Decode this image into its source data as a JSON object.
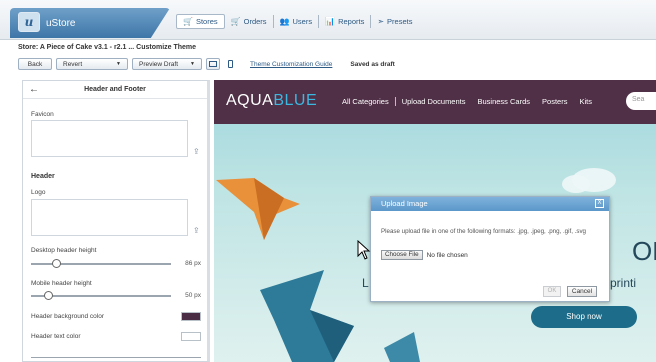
{
  "app": {
    "name": "uStore",
    "logo_letter": "u"
  },
  "nav": [
    {
      "icon": "cart-icon",
      "glyph": "🛒",
      "label": "Stores",
      "active": true
    },
    {
      "icon": "cart-icon",
      "glyph": "🛒",
      "label": "Orders",
      "active": false
    },
    {
      "icon": "users-icon",
      "glyph": "👥",
      "label": "Users",
      "active": false
    },
    {
      "icon": "reports-icon",
      "glyph": "📊",
      "label": "Reports",
      "active": false
    },
    {
      "icon": "presets-icon",
      "glyph": "➣",
      "label": "Presets",
      "active": false
    }
  ],
  "store_line": "Store: A Piece of Cake v3.1 - r2.1 ... Customize Theme",
  "toolbar": {
    "back": "Back",
    "revert": "Revert",
    "preview": "Preview Draft",
    "guide": "Theme Customization Guide",
    "status": "Saved as draft"
  },
  "sidebar": {
    "title": "Header and Footer",
    "favicon_label": "Favicon",
    "header_section": "Header",
    "logo_label": "Logo",
    "desktop_height": {
      "label": "Desktop header height",
      "value": "86 px",
      "fraction": 0.16
    },
    "mobile_height": {
      "label": "Mobile header height",
      "value": "50 px",
      "fraction": 0.1
    },
    "bg_color": {
      "label": "Header background color",
      "value": "#4a2d44"
    },
    "text_color": {
      "label": "Header text color",
      "value": "#ffffff"
    }
  },
  "preview": {
    "logo_a": "AQUA",
    "logo_b": "BLUE",
    "menu": [
      "All Categories",
      "Upload Documents",
      "Business Cards",
      "Posters",
      "Kits"
    ],
    "search": "Sea",
    "big_text": "ON",
    "line_start": "L",
    "line_end": "printi",
    "shop": "Shop now"
  },
  "modal": {
    "title": "Upload Image",
    "close": "X",
    "message": "Please upload file in one of the following formats: .jpg, .jpeg, .png, .gif, .svg",
    "choose": "Choose File",
    "no_file": "No file chosen",
    "ok": "OK",
    "cancel": "Cancel"
  },
  "colors": {
    "header_bg": "#4f3046",
    "brand_blue": "#3e76a8",
    "shop_button": "#1d6c89"
  }
}
